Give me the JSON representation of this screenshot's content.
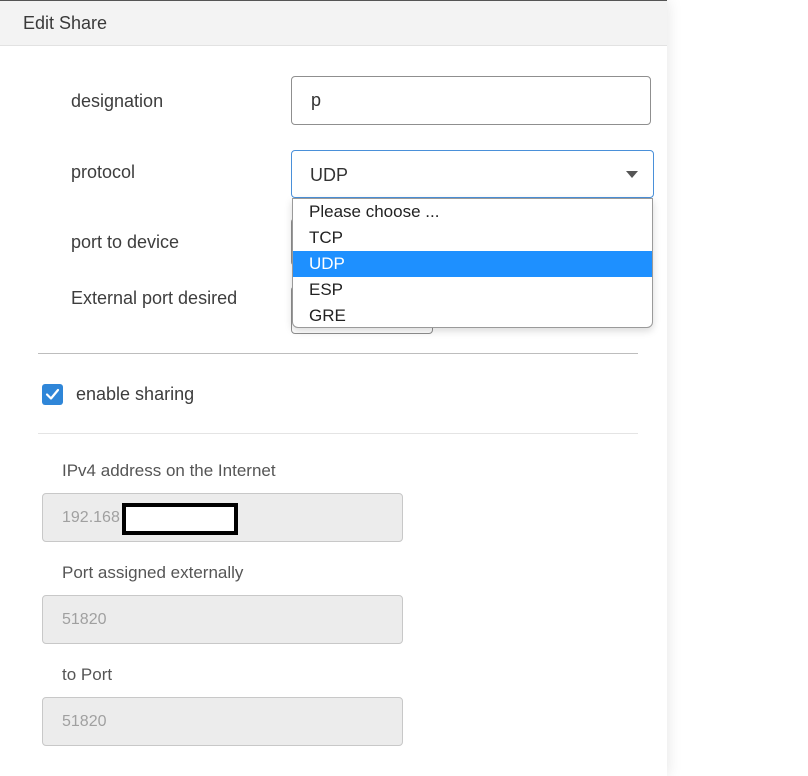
{
  "dialog": {
    "title": "Edit Share"
  },
  "form": {
    "designation": {
      "label": "designation",
      "value": "p"
    },
    "protocol": {
      "label": "protocol",
      "selected": "UDP",
      "options": [
        "Please choose ...",
        "TCP",
        "UDP",
        "ESP",
        "GRE"
      ]
    },
    "port_to_device": {
      "label": "port to device"
    },
    "external_port_desired": {
      "label": "External port desired"
    },
    "enable_sharing": {
      "label": "enable sharing",
      "checked": true
    }
  },
  "info": {
    "ipv4": {
      "label": "IPv4 address on the Internet",
      "value": "192.168"
    },
    "port_assigned": {
      "label": "Port assigned externally",
      "value": "51820"
    },
    "to_port": {
      "label": "to Port",
      "value": "51820"
    }
  },
  "colors": {
    "accent": "#2f86d8",
    "selected_option": "#1e90ff",
    "header_bg": "#f3f3f3",
    "readonly_bg": "#ececec"
  }
}
